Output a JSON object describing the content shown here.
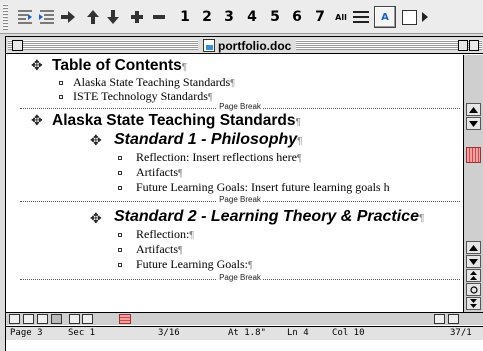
{
  "toolbar": {
    "level_numbers": [
      "1",
      "2",
      "3",
      "4",
      "5",
      "6",
      "7"
    ],
    "all_label": "All",
    "format_label": "A",
    "icons": [
      "promote-icon",
      "demote-icon",
      "demote-to-body-icon",
      "move-up-icon",
      "move-down-icon",
      "expand-icon",
      "collapse-icon",
      "first-line-only-icon",
      "show-formatting-icon",
      "master-document-icon"
    ]
  },
  "window": {
    "title": "portfolio.doc"
  },
  "document": {
    "pilcrow": "¶",
    "page_break_label": "Page Break",
    "toc": {
      "heading": "Table of Contents",
      "items": [
        "Alaska State Teaching Standards",
        "ISTE Technology Standards"
      ]
    },
    "section": {
      "heading": "Alaska State Teaching Standards",
      "standard1": {
        "heading": "Standard 1 - Philosophy",
        "items": [
          "Reflection: Insert reflections here",
          "Artifacts",
          "Future Learning Goals: Insert future learning goals h"
        ]
      },
      "standard2": {
        "heading": "Standard 2 - Learning  Theory & Practice",
        "items": [
          "Reflection:",
          "Artifacts",
          "Future Learning Goals:"
        ]
      }
    }
  },
  "status_bar": {
    "page": "Page 3",
    "sec": "Sec 1",
    "pages": "3/16",
    "at": "At 1.8\"",
    "ln": "Ln 4",
    "col": "Col 10",
    "count": "37/1"
  }
}
